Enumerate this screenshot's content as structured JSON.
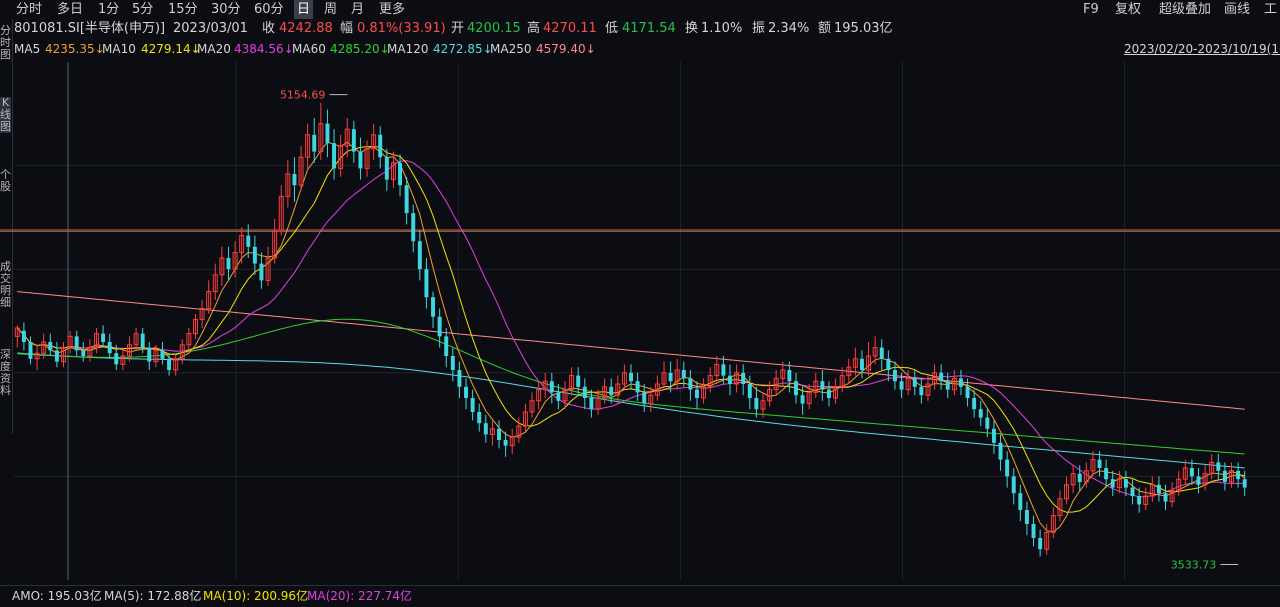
{
  "toolbar": {
    "tabs": [
      "分时",
      "多日",
      "1分",
      "5分",
      "15分",
      "30分",
      "60分",
      "日",
      "周",
      "月",
      "更多"
    ],
    "active_tab": "日",
    "right_items": [
      "F9",
      "复权",
      "超级叠加",
      "画线",
      "工"
    ]
  },
  "sidebar": {
    "items": [
      "分时图",
      "K线图",
      "个股",
      "成交明细",
      "深度资料"
    ]
  },
  "info": {
    "code": "801081.SI[半导体(申万)]",
    "date": "2023/03/01",
    "close_label": "收",
    "close": "4242.88",
    "change_label": "幅",
    "change": "0.81%(33.91)",
    "open_label": "开",
    "open": "4200.15",
    "high_label": "高",
    "high": "4270.11",
    "low_label": "低",
    "low": "4171.54",
    "turnover_label": "换",
    "turnover": "1.10%",
    "amplitude_label": "振",
    "amplitude": "2.34%",
    "amount_label": "额",
    "amount": "195.03亿"
  },
  "ma_legend": [
    {
      "name": "MA5",
      "value": "4235.35↓",
      "color": "#ffffff"
    },
    {
      "name": "MA10",
      "value": "4279.14↓",
      "color": "#f2e200"
    },
    {
      "name": "MA20",
      "value": "4384.56↓",
      "color": "#e040e0"
    },
    {
      "name": "MA60",
      "value": "4285.20↓",
      "color": "#2fd12f"
    },
    {
      "name": "MA120",
      "value": "4272.85↓",
      "color": "#5ad8e6"
    },
    {
      "name": "MA250",
      "value": "4579.40↓",
      "color": "#ff8a8a"
    }
  ],
  "date_range": "2023/02/20-2023/10/19(16",
  "amo": {
    "amo_label": "AMO: 195.03亿",
    "ma5_label": "MA(5): 172.88亿",
    "ma10_label": "MA(10): 200.96亿",
    "ma20_label": "MA(20): 227.74亿"
  },
  "colors": {
    "up": "#ff3d3d",
    "down": "#3fd6e0",
    "bg": "#0b0d12",
    "grid": "#2b2f3a"
  },
  "chart_data": {
    "type": "candlestick",
    "ylim": [
      3450,
      5300
    ],
    "annotations": [
      {
        "label": "5154.69",
        "value": 5154.69,
        "index": 47
      },
      {
        "label": "3533.73",
        "value": 3533.73,
        "index": 182
      }
    ],
    "candles": [
      [
        4320,
        4350,
        4280,
        4360
      ],
      [
        4340,
        4300,
        4270,
        4370
      ],
      [
        4300,
        4240,
        4220,
        4320
      ],
      [
        4240,
        4260,
        4200,
        4290
      ],
      [
        4260,
        4300,
        4240,
        4330
      ],
      [
        4300,
        4270,
        4250,
        4330
      ],
      [
        4270,
        4230,
        4210,
        4300
      ],
      [
        4230,
        4280,
        4210,
        4300
      ],
      [
        4280,
        4320,
        4260,
        4340
      ],
      [
        4320,
        4270,
        4250,
        4340
      ],
      [
        4270,
        4250,
        4230,
        4300
      ],
      [
        4250,
        4280,
        4230,
        4310
      ],
      [
        4280,
        4330,
        4260,
        4350
      ],
      [
        4330,
        4300,
        4280,
        4360
      ],
      [
        4300,
        4260,
        4240,
        4330
      ],
      [
        4260,
        4220,
        4200,
        4290
      ],
      [
        4220,
        4250,
        4200,
        4280
      ],
      [
        4250,
        4290,
        4230,
        4320
      ],
      [
        4290,
        4330,
        4270,
        4350
      ],
      [
        4330,
        4280,
        4260,
        4350
      ],
      [
        4280,
        4230,
        4200,
        4300
      ],
      [
        4230,
        4270,
        4210,
        4290
      ],
      [
        4270,
        4240,
        4220,
        4300
      ],
      [
        4240,
        4200,
        4180,
        4260
      ],
      [
        4200,
        4240,
        4180,
        4260
      ],
      [
        4240,
        4290,
        4220,
        4310
      ],
      [
        4290,
        4330,
        4270,
        4350
      ],
      [
        4330,
        4380,
        4310,
        4400
      ],
      [
        4380,
        4420,
        4350,
        4450
      ],
      [
        4420,
        4480,
        4400,
        4520
      ],
      [
        4480,
        4540,
        4450,
        4580
      ],
      [
        4540,
        4600,
        4500,
        4640
      ],
      [
        4600,
        4560,
        4520,
        4640
      ],
      [
        4560,
        4620,
        4530,
        4660
      ],
      [
        4620,
        4680,
        4580,
        4710
      ],
      [
        4680,
        4640,
        4600,
        4720
      ],
      [
        4640,
        4580,
        4540,
        4680
      ],
      [
        4580,
        4520,
        4490,
        4620
      ],
      [
        4520,
        4600,
        4500,
        4640
      ],
      [
        4600,
        4700,
        4580,
        4740
      ],
      [
        4700,
        4820,
        4680,
        4860
      ],
      [
        4820,
        4900,
        4780,
        4950
      ],
      [
        4900,
        4860,
        4800,
        4960
      ],
      [
        4860,
        4960,
        4840,
        5000
      ],
      [
        4960,
        5040,
        4920,
        5080
      ],
      [
        5040,
        4980,
        4940,
        5100
      ],
      [
        4980,
        5080,
        4950,
        5154.69
      ],
      [
        5080,
        5010,
        4960,
        5130
      ],
      [
        5010,
        4920,
        4880,
        5060
      ],
      [
        4920,
        5000,
        4890,
        5040
      ],
      [
        5000,
        5060,
        4960,
        5100
      ],
      [
        5060,
        4980,
        4940,
        5090
      ],
      [
        4980,
        4920,
        4880,
        5030
      ],
      [
        4920,
        4990,
        4890,
        5020
      ],
      [
        4990,
        5040,
        4950,
        5080
      ],
      [
        5040,
        4960,
        4920,
        5070
      ],
      [
        4960,
        4880,
        4840,
        4990
      ],
      [
        4880,
        4940,
        4850,
        4980
      ],
      [
        4940,
        4860,
        4820,
        4970
      ],
      [
        4860,
        4760,
        4720,
        4890
      ],
      [
        4760,
        4660,
        4620,
        4790
      ],
      [
        4660,
        4560,
        4520,
        4700
      ],
      [
        4560,
        4460,
        4420,
        4600
      ],
      [
        4460,
        4390,
        4350,
        4480
      ],
      [
        4390,
        4320,
        4280,
        4420
      ],
      [
        4320,
        4250,
        4210,
        4350
      ],
      [
        4250,
        4200,
        4160,
        4280
      ],
      [
        4200,
        4140,
        4100,
        4230
      ],
      [
        4140,
        4100,
        4060,
        4170
      ],
      [
        4100,
        4050,
        4020,
        4130
      ],
      [
        4050,
        4010,
        3980,
        4080
      ],
      [
        4010,
        3970,
        3940,
        4040
      ],
      [
        3970,
        3990,
        3930,
        4020
      ],
      [
        3990,
        3950,
        3920,
        4020
      ],
      [
        3950,
        3930,
        3890,
        3980
      ],
      [
        3930,
        3960,
        3900,
        3990
      ],
      [
        3960,
        4000,
        3940,
        4030
      ],
      [
        4000,
        4050,
        3980,
        4080
      ],
      [
        4050,
        4090,
        4030,
        4120
      ],
      [
        4090,
        4130,
        4060,
        4160
      ],
      [
        4130,
        4160,
        4100,
        4190
      ],
      [
        4160,
        4120,
        4080,
        4190
      ],
      [
        4120,
        4090,
        4060,
        4150
      ],
      [
        4090,
        4130,
        4060,
        4160
      ],
      [
        4130,
        4180,
        4110,
        4210
      ],
      [
        4180,
        4140,
        4110,
        4210
      ],
      [
        4140,
        4100,
        4060,
        4170
      ],
      [
        4100,
        4060,
        4030,
        4130
      ],
      [
        4060,
        4100,
        4040,
        4130
      ],
      [
        4100,
        4140,
        4080,
        4170
      ],
      [
        4140,
        4110,
        4080,
        4170
      ],
      [
        4110,
        4150,
        4080,
        4180
      ],
      [
        4150,
        4190,
        4130,
        4220
      ],
      [
        4190,
        4160,
        4130,
        4220
      ],
      [
        4160,
        4120,
        4090,
        4190
      ],
      [
        4120,
        4080,
        4050,
        4150
      ],
      [
        4080,
        4110,
        4050,
        4140
      ],
      [
        4110,
        4150,
        4090,
        4180
      ],
      [
        4150,
        4190,
        4130,
        4230
      ],
      [
        4190,
        4160,
        4120,
        4230
      ],
      [
        4160,
        4200,
        4130,
        4240
      ],
      [
        4200,
        4170,
        4140,
        4230
      ],
      [
        4170,
        4130,
        4090,
        4200
      ],
      [
        4130,
        4100,
        4060,
        4160
      ],
      [
        4100,
        4140,
        4080,
        4170
      ],
      [
        4140,
        4180,
        4120,
        4210
      ],
      [
        4180,
        4220,
        4150,
        4250
      ],
      [
        4220,
        4180,
        4150,
        4250
      ],
      [
        4180,
        4150,
        4110,
        4220
      ],
      [
        4150,
        4190,
        4120,
        4220
      ],
      [
        4190,
        4150,
        4110,
        4220
      ],
      [
        4150,
        4100,
        4060,
        4180
      ],
      [
        4100,
        4060,
        4030,
        4140
      ],
      [
        4060,
        4090,
        4030,
        4120
      ],
      [
        4090,
        4130,
        4070,
        4160
      ],
      [
        4130,
        4170,
        4110,
        4200
      ],
      [
        4170,
        4200,
        4140,
        4230
      ],
      [
        4200,
        4160,
        4120,
        4230
      ],
      [
        4160,
        4110,
        4080,
        4190
      ],
      [
        4110,
        4080,
        4040,
        4140
      ],
      [
        4080,
        4120,
        4060,
        4150
      ],
      [
        4120,
        4160,
        4100,
        4190
      ],
      [
        4160,
        4130,
        4090,
        4200
      ],
      [
        4130,
        4100,
        4070,
        4160
      ],
      [
        4100,
        4140,
        4080,
        4170
      ],
      [
        4140,
        4180,
        4120,
        4210
      ],
      [
        4180,
        4210,
        4150,
        4240
      ],
      [
        4210,
        4240,
        4180,
        4280
      ],
      [
        4240,
        4200,
        4170,
        4270
      ],
      [
        4200,
        4250,
        4180,
        4300
      ],
      [
        4250,
        4280,
        4220,
        4320
      ],
      [
        4280,
        4240,
        4200,
        4310
      ],
      [
        4240,
        4200,
        4160,
        4270
      ],
      [
        4200,
        4160,
        4130,
        4230
      ],
      [
        4160,
        4130,
        4100,
        4190
      ],
      [
        4130,
        4170,
        4110,
        4200
      ],
      [
        4170,
        4140,
        4110,
        4200
      ],
      [
        4140,
        4110,
        4080,
        4170
      ],
      [
        4110,
        4150,
        4090,
        4180
      ],
      [
        4150,
        4190,
        4130,
        4220
      ],
      [
        4190,
        4160,
        4130,
        4220
      ],
      [
        4160,
        4130,
        4100,
        4190
      ],
      [
        4130,
        4170,
        4110,
        4200
      ],
      [
        4170,
        4140,
        4110,
        4200
      ],
      [
        4140,
        4100,
        4070,
        4170
      ],
      [
        4100,
        4060,
        4030,
        4130
      ],
      [
        4060,
        4030,
        4000,
        4090
      ],
      [
        4030,
        3990,
        3960,
        4060
      ],
      [
        3990,
        3940,
        3900,
        4020
      ],
      [
        3940,
        3880,
        3840,
        3970
      ],
      [
        3880,
        3820,
        3780,
        3910
      ],
      [
        3820,
        3760,
        3720,
        3850
      ],
      [
        3760,
        3700,
        3660,
        3790
      ],
      [
        3700,
        3650,
        3610,
        3730
      ],
      [
        3650,
        3600,
        3570,
        3680
      ],
      [
        3600,
        3560,
        3533.73,
        3630
      ],
      [
        3560,
        3620,
        3540,
        3650
      ],
      [
        3620,
        3680,
        3600,
        3710
      ],
      [
        3680,
        3740,
        3660,
        3770
      ],
      [
        3740,
        3790,
        3720,
        3820
      ],
      [
        3790,
        3830,
        3760,
        3860
      ],
      [
        3830,
        3800,
        3770,
        3860
      ],
      [
        3800,
        3840,
        3780,
        3870
      ],
      [
        3840,
        3880,
        3820,
        3910
      ],
      [
        3880,
        3850,
        3820,
        3910
      ],
      [
        3850,
        3810,
        3780,
        3880
      ],
      [
        3810,
        3780,
        3750,
        3840
      ],
      [
        3780,
        3810,
        3760,
        3840
      ],
      [
        3810,
        3780,
        3750,
        3840
      ],
      [
        3780,
        3750,
        3720,
        3810
      ],
      [
        3750,
        3720,
        3690,
        3780
      ],
      [
        3720,
        3750,
        3700,
        3780
      ],
      [
        3750,
        3790,
        3730,
        3820
      ],
      [
        3790,
        3760,
        3730,
        3820
      ],
      [
        3760,
        3730,
        3700,
        3790
      ],
      [
        3730,
        3770,
        3710,
        3800
      ],
      [
        3770,
        3810,
        3750,
        3840
      ],
      [
        3810,
        3850,
        3790,
        3880
      ],
      [
        3850,
        3820,
        3790,
        3880
      ],
      [
        3820,
        3790,
        3760,
        3850
      ],
      [
        3790,
        3830,
        3770,
        3860
      ],
      [
        3830,
        3870,
        3810,
        3900
      ],
      [
        3870,
        3840,
        3810,
        3900
      ],
      [
        3840,
        3800,
        3770,
        3870
      ],
      [
        3800,
        3840,
        3780,
        3870
      ],
      [
        3840,
        3810,
        3780,
        3870
      ],
      [
        3810,
        3780,
        3750,
        3840
      ]
    ],
    "moving_averages": [
      {
        "name": "MA250",
        "start": 4480,
        "end": 4060,
        "color": "#ff8a8a"
      },
      {
        "name": "MA120",
        "start": 4250,
        "end": 3850,
        "color": "#5ad8e6"
      },
      {
        "name": "MA60",
        "start": 4260,
        "end": 3900,
        "color": "#2fd12f"
      }
    ],
    "reference_lines": [
      4700,
      4695
    ]
  }
}
